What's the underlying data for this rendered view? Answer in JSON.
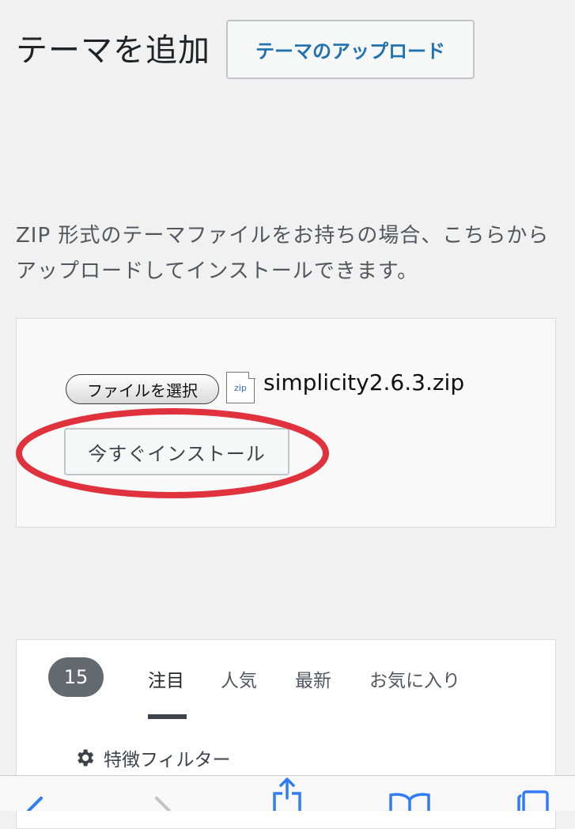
{
  "header": {
    "title": "テーマを追加",
    "upload_button_label": "テーマのアップロード"
  },
  "upload": {
    "description_line1": "ZIP 形式のテーマファイルをお持ちの場合、こちらから",
    "description_line2": "アップロードしてインストールできます。",
    "file_select_label": "ファイルを選択",
    "zip_icon_text": "zip",
    "file_name": "simplicity2.6.3.zip",
    "install_button_label": "今すぐインストール"
  },
  "filter": {
    "count": "15",
    "tabs": [
      {
        "label": "注目",
        "active": true
      },
      {
        "label": "人気",
        "active": false
      },
      {
        "label": "最新",
        "active": false
      },
      {
        "label": "お気に入り",
        "active": false
      }
    ],
    "feature_filter_label": "特徴フィルター"
  },
  "browser_toolbar": {
    "icons": [
      "back-icon",
      "forward-icon",
      "share-icon",
      "bookmarks-icon",
      "tabs-icon"
    ]
  },
  "colors": {
    "background": "#f1f1f1",
    "link_blue": "#2271b1",
    "annotation_red": "#e0323c",
    "badge_gray": "#646970"
  }
}
